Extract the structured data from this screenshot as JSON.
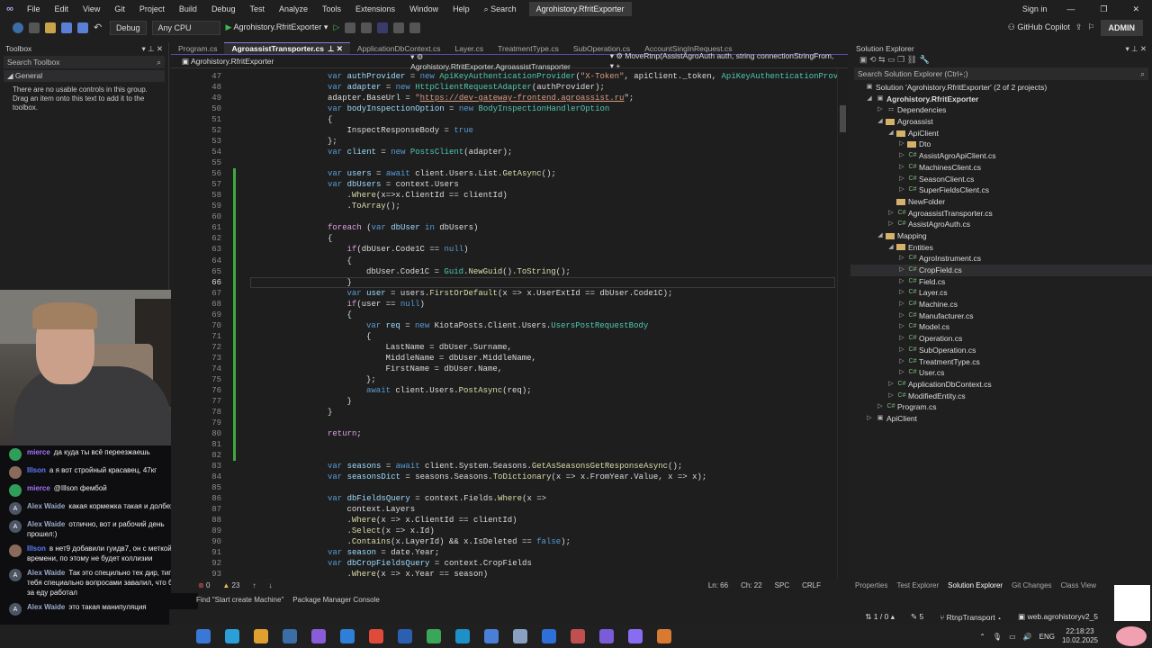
{
  "menu": {
    "items": [
      "File",
      "Edit",
      "View",
      "Git",
      "Project",
      "Build",
      "Debug",
      "Test",
      "Analyze",
      "Tools",
      "Extensions",
      "Window",
      "Help"
    ],
    "search": "Search",
    "title": "Agrohistory.RfritExporter",
    "sign_in": "Sign in"
  },
  "toolbar": {
    "config": "Debug",
    "platform": "Any CPU",
    "run_target": "Agrohistory.RfritExporter",
    "copilot": "GitHub Copilot",
    "admin": "ADMIN"
  },
  "toolbox": {
    "title": "Toolbox",
    "search": "Search Toolbox",
    "group": "General",
    "empty_text": "There are no usable controls in this group. Drag an item onto this text to add it to the toolbox."
  },
  "editor": {
    "tabs": [
      {
        "label": "Program.cs"
      },
      {
        "label": "AgroassistTransporter.cs",
        "active": true
      },
      {
        "label": "ApplicationDbContext.cs"
      },
      {
        "label": "Layer.cs"
      },
      {
        "label": "TreatmentType.cs"
      },
      {
        "label": "SubOperation.cs"
      },
      {
        "label": "AccountSingInRequest.cs"
      }
    ],
    "nav": {
      "project": "Agrohistory.RfritExporter",
      "class": "Agrohistory.RfritExporter.AgroassistTransporter",
      "member": "MoveRtnp(AssistAgroAuth auth, string connectionStringFrom,"
    },
    "current_line": 66,
    "status": {
      "errors": "0",
      "warnings": "23",
      "ln": "Ln: 66",
      "ch": "Ch: 22",
      "spc": "SPC",
      "crlf": "CRLF"
    }
  },
  "code": {
    "lines": [
      {
        "n": 47,
        "i": 0,
        "t": [
          [
            "var ",
            "k"
          ],
          [
            "authProvider",
            "v"
          ],
          [
            " = ",
            "p"
          ],
          [
            "new ",
            "k"
          ],
          [
            "ApiKeyAuthenticationProvider",
            "t"
          ],
          [
            "(",
            "p"
          ],
          [
            "\"X-Token\"",
            "s"
          ],
          [
            ", apiClient._token, ",
            "p"
          ],
          [
            "ApiKeyAuthenticationProv",
            "t"
          ]
        ]
      },
      {
        "n": 48,
        "i": 0,
        "t": [
          [
            "var ",
            "k"
          ],
          [
            "adapter",
            "v"
          ],
          [
            " = ",
            "p"
          ],
          [
            "new ",
            "k"
          ],
          [
            "HttpClientRequestAdapter",
            "t"
          ],
          [
            "(authProvider);",
            "p"
          ]
        ]
      },
      {
        "n": 49,
        "i": 0,
        "t": [
          [
            "adapter.BaseUrl = ",
            "p"
          ],
          [
            "\"",
            "s"
          ],
          [
            "https://dev-gateway-frontend.agroassist.ru",
            "u"
          ],
          [
            "\";",
            "p"
          ]
        ]
      },
      {
        "n": 50,
        "i": 0,
        "t": [
          [
            "var ",
            "k"
          ],
          [
            "bodyInspectionOption",
            "v"
          ],
          [
            " = ",
            "p"
          ],
          [
            "new ",
            "k"
          ],
          [
            "BodyInspectionHandlerOption",
            "t"
          ]
        ]
      },
      {
        "n": 51,
        "i": 0,
        "t": [
          [
            "{",
            "p"
          ]
        ]
      },
      {
        "n": 52,
        "i": 1,
        "t": [
          [
            "InspectResponseBody = ",
            "p"
          ],
          [
            "true",
            "k"
          ]
        ]
      },
      {
        "n": 53,
        "i": 0,
        "t": [
          [
            "};",
            "p"
          ]
        ]
      },
      {
        "n": 54,
        "i": 0,
        "t": [
          [
            "var ",
            "k"
          ],
          [
            "client",
            "v"
          ],
          [
            " = ",
            "p"
          ],
          [
            "new ",
            "k"
          ],
          [
            "PostsClient",
            "t"
          ],
          [
            "(adapter);",
            "p"
          ]
        ]
      },
      {
        "n": 55,
        "i": 0,
        "t": []
      },
      {
        "n": 56,
        "i": 0,
        "t": [
          [
            "var ",
            "k"
          ],
          [
            "users",
            "v"
          ],
          [
            " = ",
            "p"
          ],
          [
            "await ",
            "k"
          ],
          [
            "client.Users.List.",
            "p"
          ],
          [
            "GetAsync",
            "m"
          ],
          [
            "();",
            "p"
          ]
        ]
      },
      {
        "n": 57,
        "i": 0,
        "t": [
          [
            "var ",
            "k"
          ],
          [
            "dbUsers",
            "v"
          ],
          [
            " = context.Users",
            "p"
          ]
        ]
      },
      {
        "n": 58,
        "i": 1,
        "t": [
          [
            ".",
            "p"
          ],
          [
            "Where",
            "m"
          ],
          [
            "(x=>x.ClientId == clientId)",
            "p"
          ]
        ]
      },
      {
        "n": 59,
        "i": 1,
        "t": [
          [
            ".",
            "p"
          ],
          [
            "ToArray",
            "m"
          ],
          [
            "();",
            "p"
          ]
        ]
      },
      {
        "n": 60,
        "i": 0,
        "t": []
      },
      {
        "n": 61,
        "i": 0,
        "t": [
          [
            "foreach ",
            "c"
          ],
          [
            "(",
            "p"
          ],
          [
            "var ",
            "k"
          ],
          [
            "dbUser ",
            "v"
          ],
          [
            "in ",
            "k"
          ],
          [
            "dbUsers)",
            "p"
          ]
        ]
      },
      {
        "n": 62,
        "i": 0,
        "t": [
          [
            "{",
            "p"
          ]
        ]
      },
      {
        "n": 63,
        "i": 1,
        "t": [
          [
            "if",
            "c"
          ],
          [
            "(dbUser.Code1C == ",
            "p"
          ],
          [
            "null",
            "k"
          ],
          [
            ")",
            "p"
          ]
        ]
      },
      {
        "n": 64,
        "i": 1,
        "t": [
          [
            "{",
            "p"
          ]
        ]
      },
      {
        "n": 65,
        "i": 2,
        "t": [
          [
            "dbUser.Code1C = ",
            "p"
          ],
          [
            "Guid",
            "t"
          ],
          [
            ".",
            "p"
          ],
          [
            "NewGuid",
            "m"
          ],
          [
            "().",
            "p"
          ],
          [
            "ToString",
            "m"
          ],
          [
            "();",
            "p"
          ]
        ]
      },
      {
        "n": 66,
        "i": 1,
        "t": [
          [
            "}",
            "p"
          ]
        ]
      },
      {
        "n": 67,
        "i": 1,
        "t": [
          [
            "var ",
            "k"
          ],
          [
            "user",
            "v"
          ],
          [
            " = users.",
            "p"
          ],
          [
            "FirstOrDefault",
            "m"
          ],
          [
            "(x => x.UserExtId == dbUser.Code1C);",
            "p"
          ]
        ]
      },
      {
        "n": 68,
        "i": 1,
        "t": [
          [
            "if",
            "c"
          ],
          [
            "(user == ",
            "p"
          ],
          [
            "null",
            "k"
          ],
          [
            ")",
            "p"
          ]
        ]
      },
      {
        "n": 69,
        "i": 1,
        "t": [
          [
            "{",
            "p"
          ]
        ]
      },
      {
        "n": 70,
        "i": 2,
        "t": [
          [
            "var ",
            "k"
          ],
          [
            "req",
            "v"
          ],
          [
            " = ",
            "p"
          ],
          [
            "new ",
            "k"
          ],
          [
            "KiotaPosts.Client.Users.",
            "p"
          ],
          [
            "UsersPostRequestBody",
            "t"
          ]
        ]
      },
      {
        "n": 71,
        "i": 2,
        "t": [
          [
            "{",
            "p"
          ]
        ]
      },
      {
        "n": 72,
        "i": 3,
        "t": [
          [
            "LastName = dbUser.Surname,",
            "p"
          ]
        ]
      },
      {
        "n": 73,
        "i": 3,
        "t": [
          [
            "MiddleName = dbUser.MiddleName,",
            "p"
          ]
        ]
      },
      {
        "n": 74,
        "i": 3,
        "t": [
          [
            "FirstName = dbUser.Name,",
            "p"
          ]
        ]
      },
      {
        "n": 75,
        "i": 2,
        "t": [
          [
            "};",
            "p"
          ]
        ]
      },
      {
        "n": 76,
        "i": 2,
        "t": [
          [
            "await ",
            "k"
          ],
          [
            "client.Users.",
            "p"
          ],
          [
            "PostAsync",
            "m"
          ],
          [
            "(req);",
            "p"
          ]
        ]
      },
      {
        "n": 77,
        "i": 1,
        "t": [
          [
            "}",
            "p"
          ]
        ]
      },
      {
        "n": 78,
        "i": 0,
        "t": [
          [
            "}",
            "p"
          ]
        ]
      },
      {
        "n": 79,
        "i": 0,
        "t": []
      },
      {
        "n": 80,
        "i": 0,
        "t": [
          [
            "return",
            "c"
          ],
          [
            ";",
            "p"
          ]
        ]
      },
      {
        "n": 81,
        "i": 0,
        "t": []
      },
      {
        "n": 82,
        "i": 0,
        "t": []
      },
      {
        "n": 83,
        "i": 0,
        "t": [
          [
            "var ",
            "k"
          ],
          [
            "seasons",
            "v"
          ],
          [
            " = ",
            "p"
          ],
          [
            "await ",
            "k"
          ],
          [
            "client.System.Seasons.",
            "p"
          ],
          [
            "GetAsSeasonsGetResponseAsync",
            "m"
          ],
          [
            "();",
            "p"
          ]
        ]
      },
      {
        "n": 84,
        "i": 0,
        "t": [
          [
            "var ",
            "k"
          ],
          [
            "seasonsDict",
            "v"
          ],
          [
            " = seasons.Seasons.",
            "p"
          ],
          [
            "ToDictionary",
            "m"
          ],
          [
            "(x => x.FromYear.Value, x => x);",
            "p"
          ]
        ]
      },
      {
        "n": 85,
        "i": 0,
        "t": []
      },
      {
        "n": 86,
        "i": 0,
        "t": [
          [
            "var ",
            "k"
          ],
          [
            "dbFieldsQuery",
            "v"
          ],
          [
            " = context.Fields.",
            "p"
          ],
          [
            "Where",
            "m"
          ],
          [
            "(x =>",
            "p"
          ]
        ]
      },
      {
        "n": 87,
        "i": 1,
        "t": [
          [
            "context.Layers",
            "p"
          ]
        ]
      },
      {
        "n": 88,
        "i": 1,
        "t": [
          [
            ".",
            "p"
          ],
          [
            "Where",
            "m"
          ],
          [
            "(x => x.ClientId == clientId)",
            "p"
          ]
        ]
      },
      {
        "n": 89,
        "i": 1,
        "t": [
          [
            ".",
            "p"
          ],
          [
            "Select",
            "m"
          ],
          [
            "(x => x.Id)",
            "p"
          ]
        ]
      },
      {
        "n": 90,
        "i": 1,
        "t": [
          [
            ".",
            "p"
          ],
          [
            "Contains",
            "m"
          ],
          [
            "(x.LayerId) && x.IsDeleted == ",
            "p"
          ],
          [
            "false",
            "k"
          ],
          [
            ");",
            "p"
          ]
        ]
      },
      {
        "n": 91,
        "i": 0,
        "t": [
          [
            "var ",
            "k"
          ],
          [
            "season",
            "v"
          ],
          [
            " = date.Year;",
            "p"
          ]
        ]
      },
      {
        "n": 92,
        "i": 0,
        "t": [
          [
            "var ",
            "k"
          ],
          [
            "dbCropFieldsQuery",
            "v"
          ],
          [
            " = context.CropFields",
            "p"
          ]
        ]
      },
      {
        "n": 93,
        "i": 1,
        "t": [
          [
            ".",
            "p"
          ],
          [
            "Where",
            "m"
          ],
          [
            "(x => x.Year == season)",
            "p"
          ]
        ]
      }
    ]
  },
  "bottom_tabs": [
    "Find \"Start create Machine\"",
    "Package Manager Console"
  ],
  "solution_explorer": {
    "title": "Solution Explorer",
    "search": "Search Solution Explorer (Ctrl+;)",
    "items": [
      {
        "d": 0,
        "a": "",
        "ic": "sln",
        "label": "Solution 'Agrohistory.RfritExporter' (2 of 2 projects)"
      },
      {
        "d": 1,
        "a": "◢",
        "ic": "proj",
        "label": "Agrohistory.RfritExporter",
        "bold": true
      },
      {
        "d": 2,
        "a": "▷",
        "ic": "dep",
        "label": "Dependencies"
      },
      {
        "d": 2,
        "a": "◢",
        "ic": "folder",
        "label": "Agroassist"
      },
      {
        "d": 3,
        "a": "◢",
        "ic": "folder",
        "label": "ApiClient"
      },
      {
        "d": 4,
        "a": "▷",
        "ic": "folder",
        "label": "Dto"
      },
      {
        "d": 4,
        "a": "▷",
        "ic": "cs",
        "label": "AssistAgroApiClient.cs"
      },
      {
        "d": 4,
        "a": "▷",
        "ic": "cs",
        "label": "MachinesClient.cs"
      },
      {
        "d": 4,
        "a": "▷",
        "ic": "cs",
        "label": "SeasonClient.cs"
      },
      {
        "d": 4,
        "a": "▷",
        "ic": "cs",
        "label": "SuperFieldsClient.cs"
      },
      {
        "d": 3,
        "a": "",
        "ic": "folder",
        "label": "NewFolder"
      },
      {
        "d": 3,
        "a": "▷",
        "ic": "cs",
        "label": "AgroassistTransporter.cs"
      },
      {
        "d": 3,
        "a": "▷",
        "ic": "cs",
        "label": "AssistAgroAuth.cs"
      },
      {
        "d": 2,
        "a": "◢",
        "ic": "folder",
        "label": "Mapping"
      },
      {
        "d": 3,
        "a": "◢",
        "ic": "folder",
        "label": "Entities"
      },
      {
        "d": 4,
        "a": "▷",
        "ic": "cs",
        "label": "AgroInstrument.cs"
      },
      {
        "d": 4,
        "a": "▷",
        "ic": "cs",
        "label": "CropField.cs",
        "sel": true
      },
      {
        "d": 4,
        "a": "▷",
        "ic": "cs",
        "label": "Field.cs"
      },
      {
        "d": 4,
        "a": "▷",
        "ic": "cs",
        "label": "Layer.cs"
      },
      {
        "d": 4,
        "a": "▷",
        "ic": "cs",
        "label": "Machine.cs"
      },
      {
        "d": 4,
        "a": "▷",
        "ic": "cs",
        "label": "Manufacturer.cs"
      },
      {
        "d": 4,
        "a": "▷",
        "ic": "cs",
        "label": "Model.cs"
      },
      {
        "d": 4,
        "a": "▷",
        "ic": "cs",
        "label": "Operation.cs"
      },
      {
        "d": 4,
        "a": "▷",
        "ic": "cs",
        "label": "SubOperation.cs"
      },
      {
        "d": 4,
        "a": "▷",
        "ic": "cs",
        "label": "TreatmentType.cs"
      },
      {
        "d": 4,
        "a": "▷",
        "ic": "cs",
        "label": "User.cs"
      },
      {
        "d": 3,
        "a": "▷",
        "ic": "cs",
        "label": "ApplicationDbContext.cs"
      },
      {
        "d": 3,
        "a": "▷",
        "ic": "cs",
        "label": "ModifiedEntity.cs"
      },
      {
        "d": 2,
        "a": "▷",
        "ic": "cs",
        "label": "Program.cs"
      },
      {
        "d": 1,
        "a": "▷",
        "ic": "proj",
        "label": "ApiClient"
      }
    ],
    "tabs": [
      "Properties",
      "Test Explorer",
      "Solution Explorer",
      "Git Changes",
      "Class View"
    ]
  },
  "statusbar": {
    "sync": "1 / 0",
    "edits": "5",
    "branch": "RtnpTransport",
    "repo": "web.agrohistoryv2_5"
  },
  "chat": [
    {
      "nick": "mierce",
      "color": "#a970ff",
      "avatar": "#2f9e5a",
      "text": "да куда ты всё переезжаешь"
    },
    {
      "nick": "Illson",
      "color": "#5b7cff",
      "avatar": "#8a6a5a",
      "text": "а я вот стройный красавец, 47кг"
    },
    {
      "nick": "mierce",
      "color": "#a970ff",
      "avatar": "#2f9e5a",
      "text": "@Illson фембой"
    },
    {
      "nick": "Alex Waide",
      "color": "#9aa8c8",
      "avatar": "#4b5563",
      "text": "какая кормежка такая и долбежка"
    },
    {
      "nick": "Alex Waide",
      "color": "#9aa8c8",
      "avatar": "#4b5563",
      "text": "отлично, вот и рабочий день прошел:)"
    },
    {
      "nick": "Illson",
      "color": "#5b7cff",
      "avatar": "#8a6a5a",
      "text": "в нет9 добавили гуидв7, он с меткой времени, по этому не будет коллизии"
    },
    {
      "nick": "Alex Waide",
      "color": "#9aa8c8",
      "avatar": "#4b5563",
      "text": "Так это специльно тех дир, типо тебя специально вопросами завалил, что бы ты за еду работал"
    },
    {
      "nick": "Alex Waide",
      "color": "#9aa8c8",
      "avatar": "#4b5563",
      "text": "это такая манипуляция"
    }
  ],
  "tray": {
    "lang": "ENG",
    "time": "22:18:23",
    "date": "10.02.2025"
  }
}
